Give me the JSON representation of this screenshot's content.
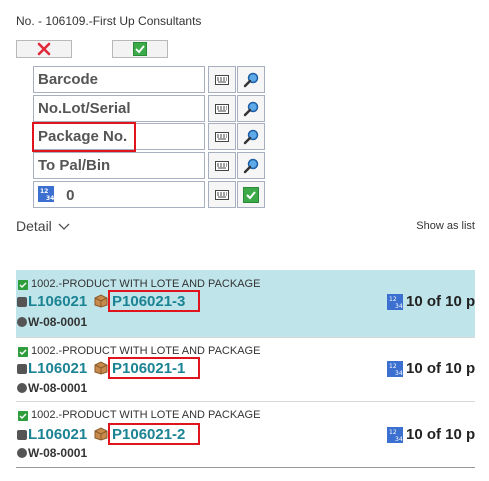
{
  "header": {
    "title": "No. - 106109.-First Up Consultants"
  },
  "form": {
    "fields": [
      {
        "label": "Barcode"
      },
      {
        "label": "No.Lot/Serial"
      },
      {
        "label": "Package No."
      },
      {
        "label": "To Pal/Bin"
      }
    ],
    "quantity_value": "0"
  },
  "detail": {
    "label": "Detail",
    "show_as_list": "Show as list"
  },
  "items": [
    {
      "product": "1002.-PRODUCT WITH LOTE AND PACKAGE",
      "lot": "L106021",
      "package": "P106021-3",
      "bin": "W-08-0001",
      "qty": "10 of 10 p",
      "selected": true
    },
    {
      "product": "1002.-PRODUCT WITH LOTE AND PACKAGE",
      "lot": "L106021",
      "package": "P106021-1",
      "bin": "W-08-0001",
      "qty": "10 of 10 p",
      "selected": false
    },
    {
      "product": "1002.-PRODUCT WITH LOTE AND PACKAGE",
      "lot": "L106021",
      "package": "P106021-2",
      "bin": "W-08-0001",
      "qty": "10 of 10 p",
      "selected": false
    }
  ],
  "icons": {
    "cancel": "x-icon",
    "confirm": "check-icon",
    "keyboard": "keyboard-icon",
    "search": "magnifier-icon",
    "numeric": "numeric-icon",
    "package": "box-icon"
  },
  "colors": {
    "accent": "#1b8393",
    "selected_row": "#bfe5ea",
    "highlight": "#e0141c",
    "success": "#2e9e3c"
  }
}
